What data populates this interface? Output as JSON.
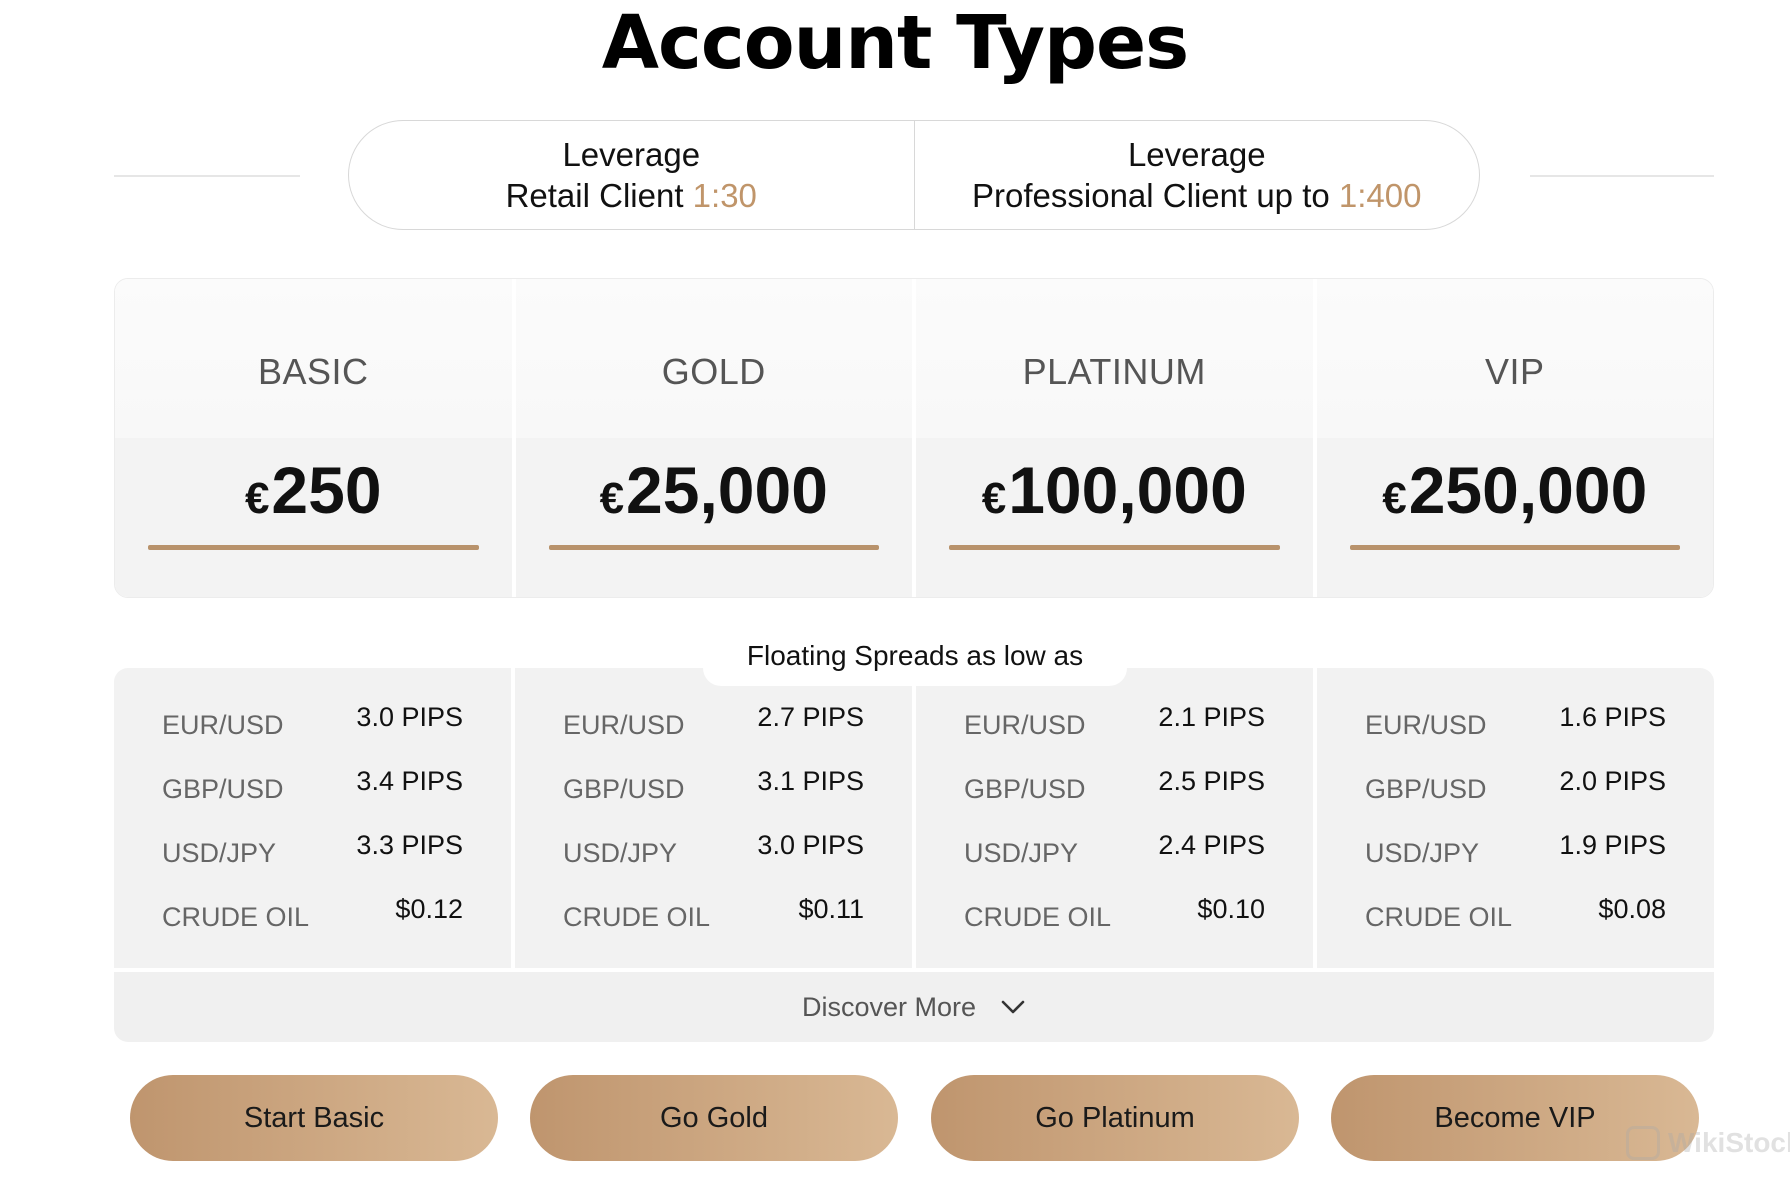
{
  "page": {
    "title": "Account Types"
  },
  "leverage": {
    "retail": {
      "heading": "Leverage",
      "label": "Retail Client",
      "value": "1:30"
    },
    "professional": {
      "heading": "Leverage",
      "label": "Professional Client up to",
      "value": "1:400"
    }
  },
  "currency_symbol": "€",
  "tiers": [
    {
      "name": "BASIC",
      "price": "250"
    },
    {
      "name": "GOLD",
      "price": "25,000"
    },
    {
      "name": "PLATINUM",
      "price": "100,000"
    },
    {
      "name": "VIP",
      "price": "250,000"
    }
  ],
  "spreads": {
    "label": "Floating Spreads as low as",
    "pairs": [
      "EUR/USD",
      "GBP/USD",
      "USD/JPY",
      "CRUDE OIL"
    ],
    "columns": [
      [
        "3.0 PIPS",
        "3.4 PIPS",
        "3.3 PIPS",
        "$0.12"
      ],
      [
        "2.7 PIPS",
        "3.1 PIPS",
        "3.0 PIPS",
        "$0.11"
      ],
      [
        "2.1 PIPS",
        "2.5 PIPS",
        "2.4 PIPS",
        "$0.10"
      ],
      [
        "1.6 PIPS",
        "2.0 PIPS",
        "1.9 PIPS",
        "$0.08"
      ]
    ]
  },
  "discover": {
    "label": "Discover More",
    "icon": "chevron-down-icon"
  },
  "buttons": [
    "Start Basic",
    "Go Gold",
    "Go Platinum",
    "Become VIP"
  ],
  "watermark": {
    "text": "WikiStock"
  },
  "colors": {
    "accent": "#c0956a",
    "bar": "#b8926b",
    "button_start": "#bf956e",
    "button_end": "#d9b894"
  }
}
